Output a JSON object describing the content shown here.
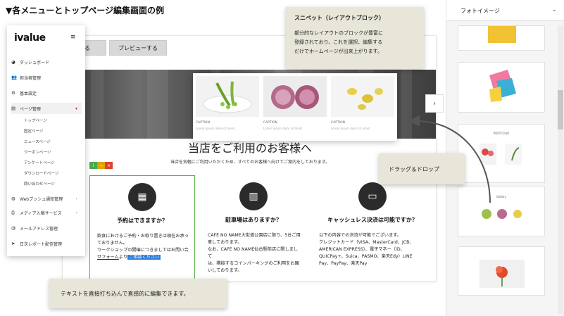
{
  "heading": "▼各メニューとトップページ編集画面の例",
  "editor": {
    "toolbar": {
      "save_label": "する",
      "preview_label": "プレビューする"
    },
    "hero_title": "当店をご利用のお客様へ",
    "hero_subtitle": "当店を気軽にご利用いただくため、すべてのお客様へ向けてご案内をしております。",
    "minitools": [
      "i",
      "−",
      "×"
    ],
    "columns": [
      {
        "icon": "calendar-icon",
        "glyph": "▦",
        "title": "予約はできますか？",
        "lines": [
          "飲食におけるご予約・お取り置きは現在お承っ",
          "ておりません。",
          "ワークショップの開催につきましてはお問い合"
        ],
        "link_text": "せフォーム",
        "link_after": "より",
        "highlight": "ご相談ください"
      },
      {
        "icon": "building-icon",
        "glyph": "▥",
        "title": "駐車場はありますか？",
        "lines": [
          "CAFE NO NAME大街道公園店に限り、5台ご用",
          "意しております。",
          "なお、CAFE NO NAME仙台駅前店に関しまして",
          "は、隣接するコインパーキングのご利用をお願",
          "いしております。"
        ]
      },
      {
        "icon": "credit-card-icon",
        "glyph": "▭",
        "title": "キャッシュレス決済は可能ですか？",
        "lines": [
          "以下の内容での決済が可能でございます。",
          "クレジットカード（VISA、MasterCard、JCB、",
          "AMERICAN EXPRESS）、電子マネー（iD、",
          "QUICPay+、Suica、PASMO、楽天Edy）LINE",
          "Pay、PayPay、楽天Pay"
        ]
      }
    ]
  },
  "snippet": {
    "items": [
      {
        "caption": "CAPTION",
        "text": "Lorem ipsum dolor sit amet"
      },
      {
        "caption": "CAPTION",
        "text": "Lorem ipsum dolor sit amet"
      },
      {
        "caption": "CAPTION",
        "text": "Lorem ipsum dolor sit amet"
      }
    ]
  },
  "sidebar": {
    "logo": "ivalue",
    "items": [
      {
        "label": "ダッシュボード",
        "icon": "palette-icon",
        "glyph": "◕"
      },
      {
        "label": "担当者管理",
        "icon": "users-icon",
        "glyph": "👥"
      },
      {
        "label": "基本設定",
        "icon": "gear-icon",
        "glyph": "⚙"
      },
      {
        "label": "ページ管理",
        "icon": "document-icon",
        "glyph": "▤",
        "active": true
      }
    ],
    "sub_items": [
      "トップページ",
      "固定ページ",
      "ニュースページ",
      "クーポンページ",
      "アンケートページ",
      "ダウンロードページ",
      "問い合わせページ"
    ],
    "bottom_items": [
      {
        "label": "Webプッシュ通知管理",
        "icon": "globe-icon",
        "glyph": "◍"
      },
      {
        "label": "メディア入稿サービス",
        "icon": "printer-icon",
        "glyph": "⎙"
      },
      {
        "label": "メールアドレス管理",
        "icon": "at-icon",
        "glyph": "@"
      },
      {
        "label": "日次レポート配信管理",
        "icon": "send-icon",
        "glyph": "➤"
      }
    ]
  },
  "callouts": {
    "snippet_title": "スニペット（レイアウトブロック）",
    "snippet_body": [
      "部分的なレイアウトのブロックが豊富に",
      "登録されており、これを選択、編集する",
      "だけでホームページが出来上がります。"
    ],
    "drag_drop": "ドラッグ＆ドロップ",
    "direct_edit": "テキストを直接打ち込んで直感的に編集できます。"
  },
  "right_panel": {
    "title": "フォトイメージ",
    "thumb_labels": [
      "PORTFOLIO",
      "Gallery"
    ]
  },
  "colors": {
    "callout_bg": "#e8e6d9",
    "selection_green": "#5cae4c",
    "highlight_blue": "#2c7bd6",
    "minitool_green": "#4aa84a",
    "minitool_yellow": "#e0a400",
    "minitool_red": "#d9432f"
  }
}
